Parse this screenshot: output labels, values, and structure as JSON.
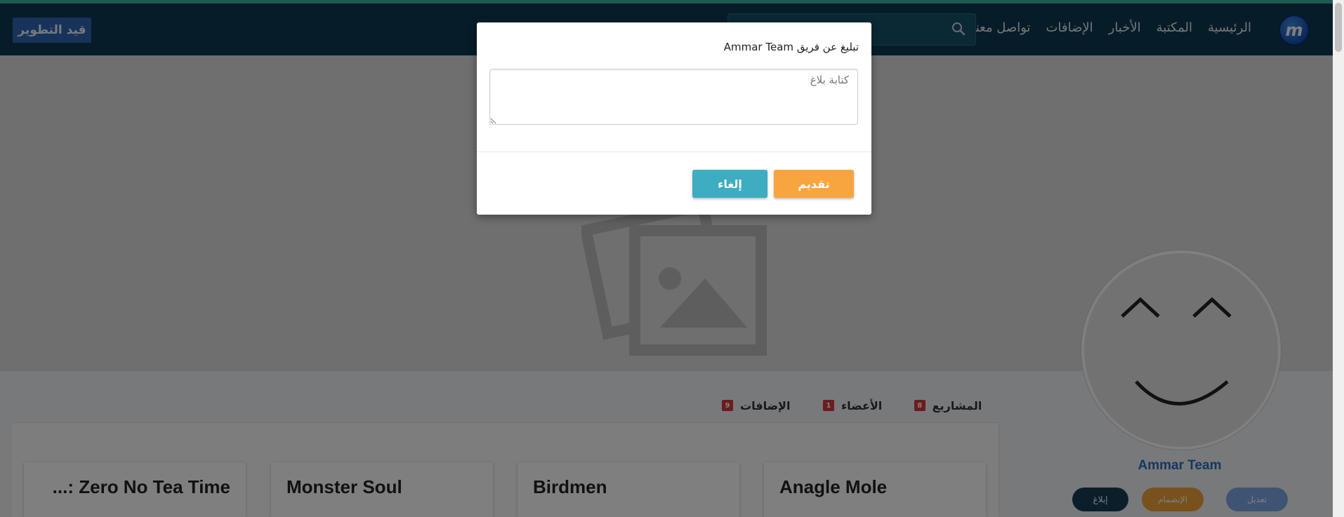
{
  "nav": {
    "logo_letter": "m",
    "items": [
      "الرئيسية",
      "المكتبة",
      "الأخبار",
      "الإضافات",
      "تواصل معنا"
    ],
    "search_placeholder": "",
    "dev_badge": "قيد التطوير"
  },
  "profile": {
    "team_name": "Ammar Team",
    "buttons": {
      "edit": "تعديل",
      "join": "الإنضمام",
      "report": "إبلاغ"
    },
    "tabs": [
      {
        "label": "المشاريع",
        "count": "8"
      },
      {
        "label": "الأعضاء",
        "count": "1"
      },
      {
        "label": "الإضافات",
        "count": "9"
      }
    ]
  },
  "projects": [
    {
      "title": "Anagle Mole"
    },
    {
      "title": "Birdmen"
    },
    {
      "title": "Monster Soul"
    },
    {
      "title": "Zero No Tea Time :..."
    }
  ],
  "modal": {
    "title": "تبليغ عن فريق Ammar Team",
    "textarea_placeholder": "كتابة بلاغ",
    "submit_label": "تقديم",
    "cancel_label": "إلغاء"
  },
  "colors": {
    "navbar": "#0d3b52",
    "accent_orange": "#f9a53f",
    "accent_teal": "#3eacc1",
    "tab_underline": "#f5b814",
    "badge_red": "#d9363e",
    "team_name_blue": "#2b6fc4"
  }
}
